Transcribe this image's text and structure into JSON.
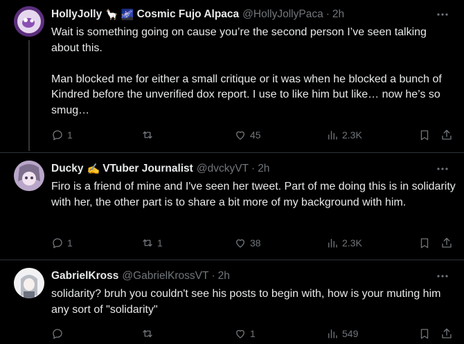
{
  "tweets": [
    {
      "name": "HollyJolly",
      "emoji1": "🦙",
      "emoji2": "🌌",
      "name2": "Cosmic Fujo Alpaca",
      "handle": "@HollyJollyPaca",
      "dot": "·",
      "time": "2h",
      "text_lines": [
        "Wait is something going on cause you’re the second person I’ve seen talking about this.",
        "",
        "Man blocked me for either a small critique or it was when he blocked a bunch of Kindred before the unverified dox report. I use to like him but like… now he’s so smug…"
      ],
      "replies": "1",
      "retweets": "",
      "likes": "45",
      "views": "2.3K",
      "avatar_color": "#6b3f8f",
      "avatar_label": "HOLLYJOLLY"
    },
    {
      "name": "Ducky",
      "emoji1": "✍",
      "name2": "VTuber Journalist",
      "handle": "@dvckyVT",
      "dot": "·",
      "time": "2h",
      "text_lines": [
        "Firo is a friend of mine and I've seen her tweet. Part of me doing this is in solidarity with her, the other part is to share a bit more of my background with him."
      ],
      "replies": "1",
      "retweets": "1",
      "likes": "38",
      "views": "2.3K",
      "avatar_color": "#c8b6d8"
    },
    {
      "name": "GabrielKross",
      "handle": "@GabrielKrossVT",
      "dot": "·",
      "time": "2h",
      "text_lines": [
        "solidarity? bruh you couldn't see his posts to begin with, how is your muting him any sort of \"solidarity\""
      ],
      "replies": "",
      "retweets": "",
      "likes": "1",
      "views": "549",
      "avatar_color": "#e8e8ea"
    }
  ],
  "colors": {
    "background": "#000000",
    "text": "#e7e9ea",
    "muted": "#71767b",
    "separator": "#2f3336"
  },
  "icons": [
    "reply-icon",
    "retweet-icon",
    "like-icon",
    "views-icon",
    "bookmark-icon",
    "share-icon",
    "more-icon"
  ]
}
